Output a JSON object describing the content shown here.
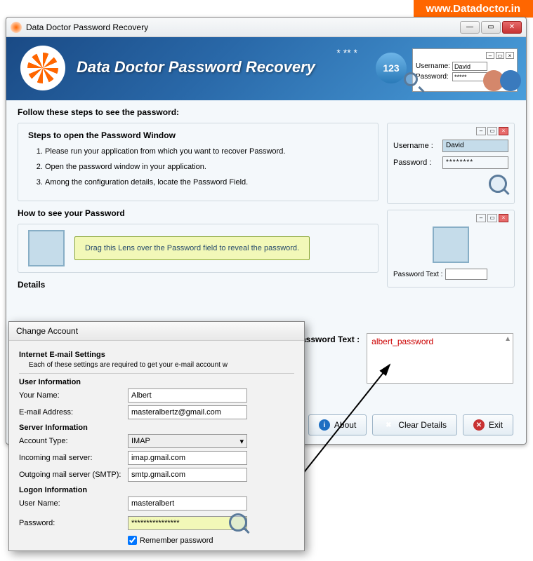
{
  "url": "www.Datadoctor.in",
  "window": {
    "title": "Data Doctor Password Recovery"
  },
  "banner": {
    "title": "Data Doctor Password Recovery",
    "stars": "* ** *",
    "bubble": "123",
    "mini": {
      "username_label": "Username:",
      "username_value": "David",
      "password_label": "Password:",
      "password_value": "*****"
    }
  },
  "content": {
    "follow": "Follow these steps to see the password:",
    "steps_title": "Steps to open the Password Window",
    "steps": [
      "Please run your application from which you want to recover Password.",
      "Open the password window in your application.",
      "Among the configuration details, locate the Password Field."
    ],
    "howto_title": "How to see your Password",
    "hint": "Drag this Lens over the Password field to reveal the password.",
    "details_title": "Details"
  },
  "illust": {
    "username_label": "Username :",
    "username_value": "David",
    "password_label": "Password :",
    "password_value": "********",
    "pt_label": "Password Text :"
  },
  "result": {
    "label": "Password Text :",
    "value": "albert_password"
  },
  "buttons": {
    "about": "About",
    "clear": "Clear Details",
    "exit": "Exit"
  },
  "dialog": {
    "title": "Change Account",
    "heading": "Internet E-mail Settings",
    "sub": "Each of these settings are required to get your e-mail account w",
    "user_info": "User Information",
    "your_name": "Your Name:",
    "your_name_v": "Albert",
    "email": "E-mail Address:",
    "email_v": "masteralbertz@gmail.com",
    "server_info": "Server Information",
    "account_type": "Account Type:",
    "account_type_v": "IMAP",
    "incoming": "Incoming mail server:",
    "incoming_v": "imap.gmail.com",
    "outgoing": "Outgoing mail server (SMTP):",
    "outgoing_v": "smtp.gmail.com",
    "logon_info": "Logon Information",
    "username": "User Name:",
    "username_v": "masteralbert",
    "password": "Password:",
    "password_v": "****************",
    "remember": "Remember password"
  }
}
